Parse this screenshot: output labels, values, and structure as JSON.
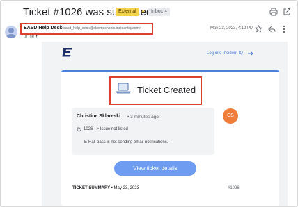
{
  "header": {
    "subject": "Ticket #1026 was submitted",
    "external_badge": "External",
    "inbox_badge": "Inbox ×"
  },
  "message_meta": {
    "sender_name": "EASD Help Desk",
    "sender_email": "<easd_help_desk@elownschools.incidentiq.com>",
    "recipient": "to me ▾",
    "date": "May 23, 2023, 4:12 PM"
  },
  "email": {
    "login_link": "Log into Incident IQ",
    "heading": "Ticket Created",
    "comment": {
      "author": "Christine Sklareski",
      "time": "• 3 minutes ago",
      "ticket_ref": "1026 - > Issue not listed",
      "message": "E-Hall pass is not sending email notifications.",
      "avatar_initials": "CS"
    },
    "button_label": "View ticket details",
    "summary_label": "TICKET SUMMARY",
    "summary_date": " • May 23, 2023",
    "ticket_number": "#1026"
  },
  "colors": {
    "accent_blue": "#4d7fd6",
    "highlight_red": "#d9432f",
    "external_yellow": "#f4d24c",
    "avatar_orange": "#ef7d3a"
  }
}
